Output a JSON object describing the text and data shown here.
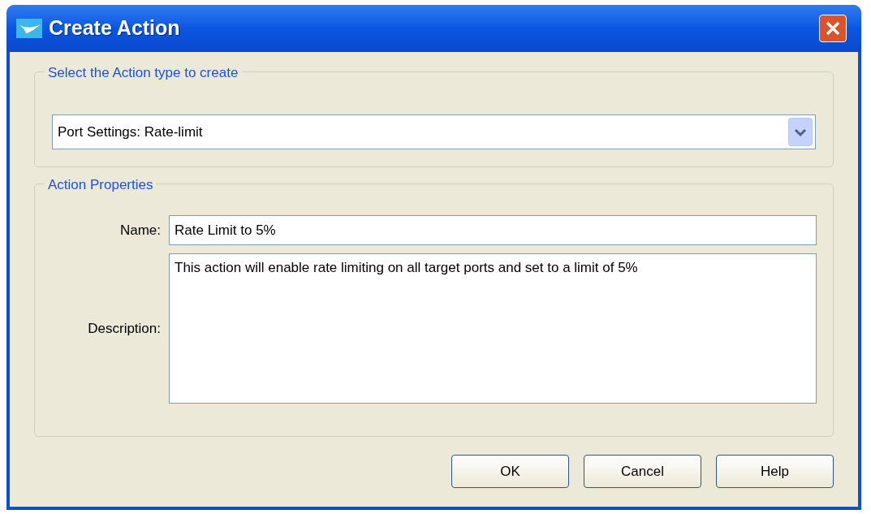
{
  "window": {
    "title": "Create Action"
  },
  "type_group": {
    "legend": "Select the Action type to create",
    "selection": "Port Settings: Rate-limit"
  },
  "properties_group": {
    "legend": "Action Properties",
    "fields": [
      {
        "label": "Name:",
        "value": "Rate Limit to 5%",
        "kind": "line"
      },
      {
        "label": "Description:",
        "value": "This action will enable rate limiting on all target ports and set to a limit of 5%",
        "kind": "area"
      }
    ]
  },
  "buttons": [
    "OK",
    "Cancel",
    "Help"
  ]
}
